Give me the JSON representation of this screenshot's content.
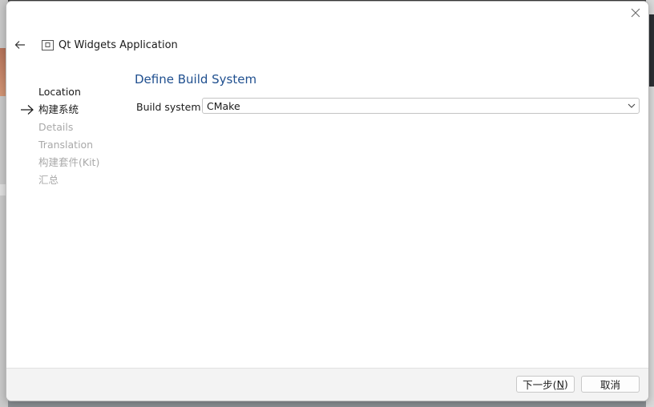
{
  "header": {
    "title": "Qt Widgets Application"
  },
  "steps": [
    {
      "label": "Location",
      "state": "done"
    },
    {
      "label": "构建系统",
      "state": "current"
    },
    {
      "label": "Details",
      "state": "pending"
    },
    {
      "label": "Translation",
      "state": "pending"
    },
    {
      "label": "构建套件(Kit)",
      "state": "pending"
    },
    {
      "label": "汇总",
      "state": "pending"
    }
  ],
  "page": {
    "title": "Define Build System",
    "build_system_label": "Build system:",
    "build_system_value": "CMake"
  },
  "footer": {
    "next_label_prefix": "下一步(",
    "next_mnemonic": "N",
    "next_label_suffix": ")",
    "cancel_label": "取消"
  },
  "colors": {
    "title_blue": "#1f4f8f",
    "pending_gray": "#a9a9a9",
    "footer_bg": "#f3f3f3"
  },
  "icons": {
    "close": "close-icon",
    "back": "back-arrow-icon",
    "app": "qt-project-icon",
    "current_step": "arrow-right-icon",
    "dropdown": "chevron-down-icon"
  }
}
